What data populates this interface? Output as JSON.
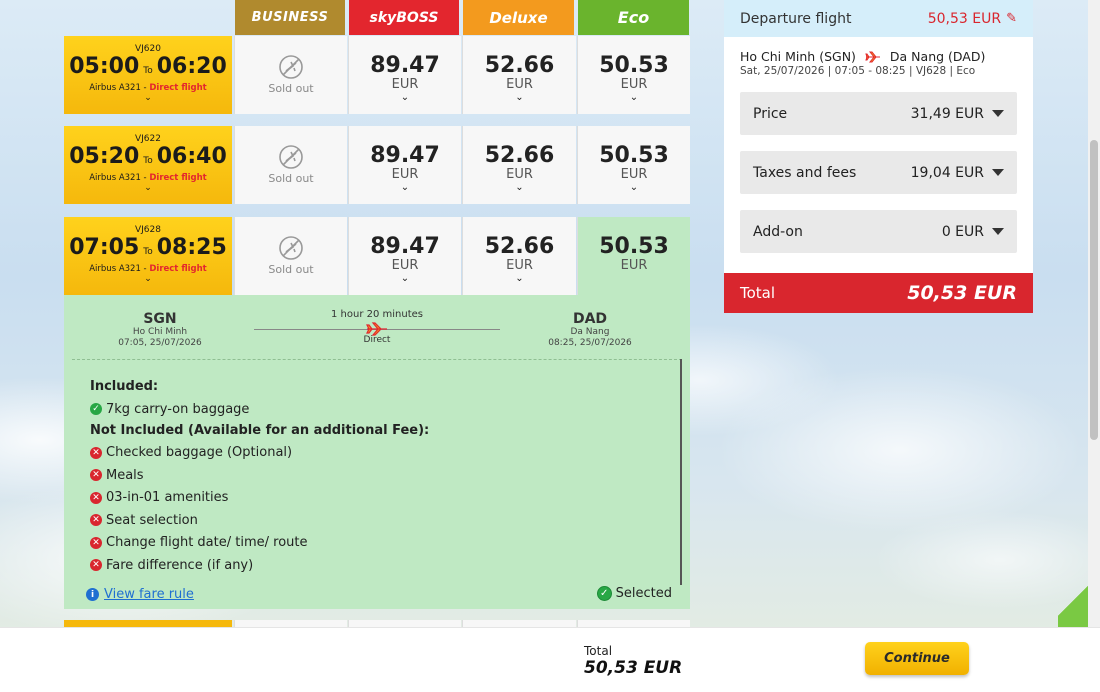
{
  "fare_classes": {
    "business": "BUSINESS",
    "skyboss": "skyBOSS",
    "deluxe": "Deluxe",
    "eco": "Eco"
  },
  "flights": [
    {
      "flight_no": "VJ620",
      "depart": "05:00",
      "to": "To",
      "arrive": "06:20",
      "aircraft": "Airbus A321 -",
      "type": "Direct flight",
      "business": "Sold out",
      "skyboss": "89.47",
      "deluxe": "52.66",
      "eco": "50.53",
      "currency": "EUR"
    },
    {
      "flight_no": "VJ622",
      "depart": "05:20",
      "to": "To",
      "arrive": "06:40",
      "aircraft": "Airbus A321 -",
      "type": "Direct flight",
      "business": "Sold out",
      "skyboss": "89.47",
      "deluxe": "52.66",
      "eco": "50.53",
      "currency": "EUR"
    },
    {
      "flight_no": "VJ628",
      "depart": "07:05",
      "to": "To",
      "arrive": "08:25",
      "aircraft": "Airbus A321 -",
      "type": "Direct flight",
      "business": "Sold out",
      "skyboss": "89.47",
      "deluxe": "52.66",
      "eco": "50.53",
      "currency": "EUR"
    }
  ],
  "detail": {
    "origin": {
      "code": "SGN",
      "city": "Ho Chi Minh",
      "datetime": "07:05, 25/07/2026"
    },
    "destination": {
      "code": "DAD",
      "city": "Da Nang",
      "datetime": "08:25, 25/07/2026"
    },
    "duration": "1 hour 20 minutes",
    "stops": "Direct",
    "included_header": "Included:",
    "included": [
      "7kg carry-on baggage"
    ],
    "not_included_header": "Not Included (Available for an additional Fee):",
    "not_included": [
      "Checked baggage (Optional)",
      "Meals",
      "03-in-01 amenities",
      "Seat selection",
      "Change flight date/ time/ route",
      "Fare difference (if any)"
    ],
    "fare_rule_link": "View fare rule",
    "selected_label": "Selected"
  },
  "summary": {
    "title": "Departure flight",
    "amount": "50,53 EUR",
    "route_from": "Ho Chi Minh (SGN)",
    "route_to": "Da Nang (DAD)",
    "route_sub": "Sat, 25/07/2026 | 07:05 - 08:25 | VJ628 | Eco",
    "items": [
      {
        "label": "Price",
        "value": "31,49 EUR"
      },
      {
        "label": "Taxes and fees",
        "value": "19,04 EUR"
      },
      {
        "label": "Add-on",
        "value": "0 EUR"
      }
    ],
    "total_label": "Total",
    "total_value": "50,53 EUR"
  },
  "bottom": {
    "total_label": "Total",
    "total_value": "50,53 EUR",
    "continue_label": "Continue"
  },
  "colors": {
    "accent_red": "#d9262e",
    "accent_yellow": "#f5b80c",
    "selected_green": "#bfe9c3",
    "link_blue": "#1f6fd1"
  }
}
